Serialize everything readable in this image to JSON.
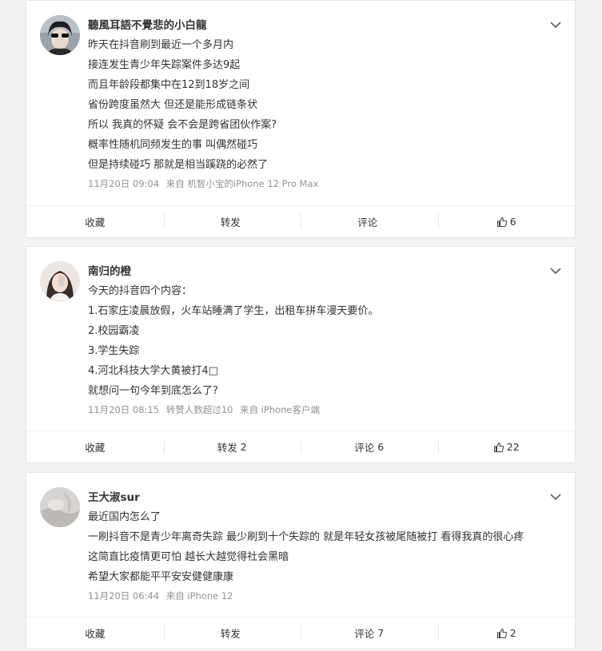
{
  "posts": [
    {
      "user_name": "聽風耳語不覺悲的小白龍",
      "avatar": "avatar-user-1",
      "lines": [
        "昨天在抖音刷到最近一个多月内",
        "接连发生青少年失踪案件多达9起",
        "而且年龄段都集中在12到18岁之间",
        "省份跨度虽然大 但还是能形成链条状",
        "所以 我真的怀疑 会不会是跨省团伙作案?",
        "概率性随机同频发生的事 叫偶然碰巧",
        "但是持续碰巧 那就是相当蹊跷的必然了"
      ],
      "meta": [
        "11月20日 09:04",
        "来自 机智小宝的iPhone 12 Pro Max"
      ],
      "actions": {
        "favorite": "收藏",
        "repost": "转发",
        "repost_count": "",
        "comment": "评论",
        "comment_count": "",
        "like_count": "6"
      }
    },
    {
      "user_name": "南归的橙",
      "avatar": "avatar-user-2",
      "lines": [
        "今天的抖音四个内容：",
        "1.石家庄凌晨放假，火车站睡满了学生，出租车拼车漫天要价。",
        "2.校园霸凌",
        "3.学生失踪",
        "4.河北科技大学大黄被打4□",
        "就想问一句今年到底怎么了?"
      ],
      "meta": [
        "11月20日 08:15",
        "转赞人数超过10",
        "来自 iPhone客户端"
      ],
      "actions": {
        "favorite": "收藏",
        "repost": "转发",
        "repost_count": "2",
        "comment": "评论",
        "comment_count": "6",
        "like_count": "22"
      }
    },
    {
      "user_name": "王大淑sur",
      "avatar": "avatar-user-3",
      "lines": [
        "最近国内怎么了",
        "一刷抖音不是青少年离奇失踪 最少刷到十个失踪的 就是年轻女孩被尾随被打 看得我真的很心疼",
        "这简直比疫情更可怕 越长大越觉得社会黑暗",
        "希望大家都能平平安安健健康康"
      ],
      "meta": [
        "11月20日 06:44",
        "来自 iPhone 12"
      ],
      "actions": {
        "favorite": "收藏",
        "repost": "转发",
        "repost_count": "",
        "comment": "评论",
        "comment_count": "7",
        "like_count": "2"
      }
    }
  ],
  "icons": {
    "more": "chevron-down-icon",
    "like": "thumbs-up-icon"
  }
}
